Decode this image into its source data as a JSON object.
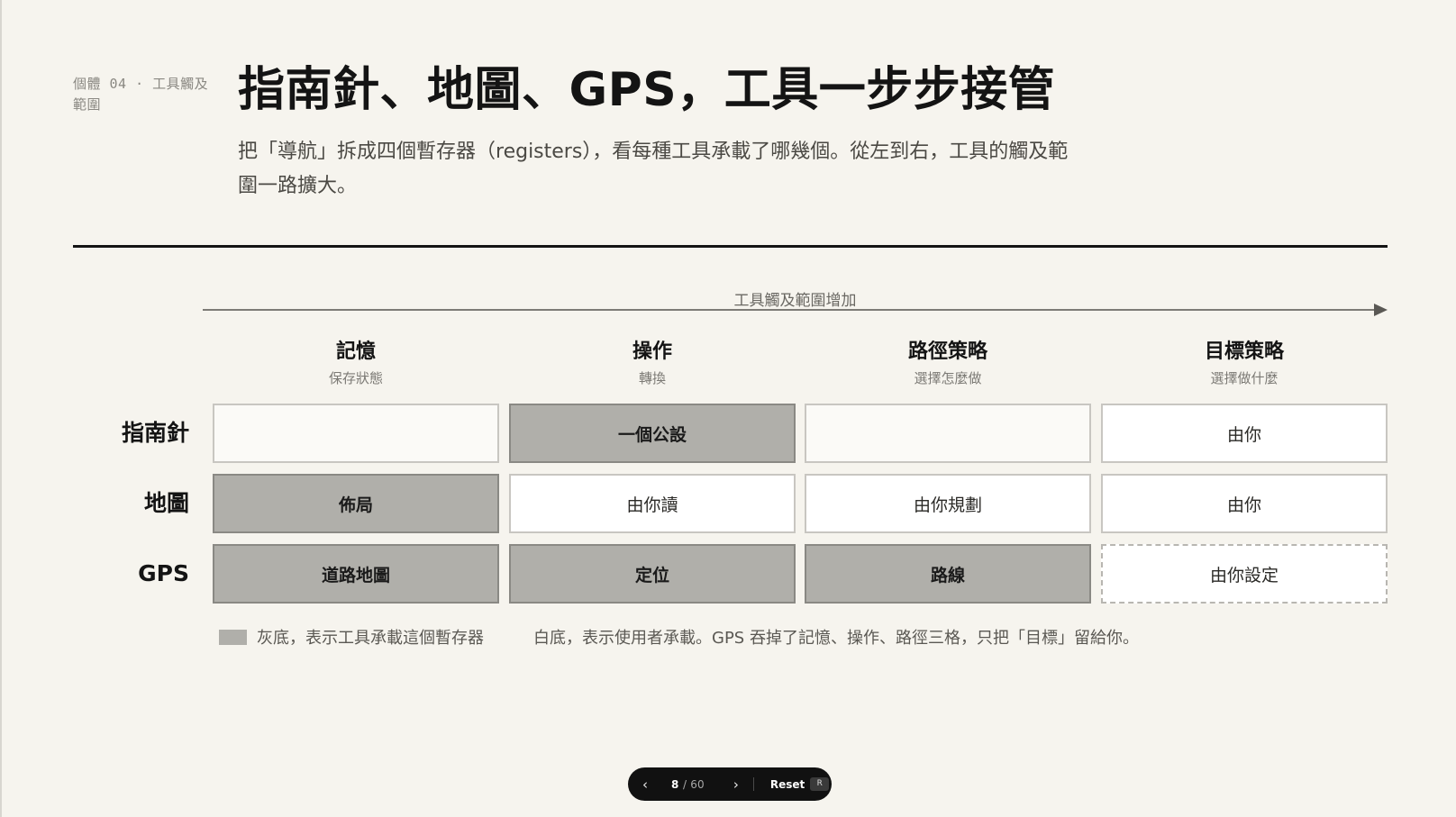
{
  "header": {
    "eyebrow": "個體 04 · 工具觸及範圍",
    "title": "指南針、地圖、GPS，工具一步步接管",
    "subtitle": "把「導航」拆成四個暫存器（registers），看每種工具承載了哪幾個。從左到右，工具的觸及範圍一路擴大。"
  },
  "axis": {
    "label": "工具觸及範圍增加"
  },
  "columns": [
    {
      "name": "記憶",
      "sub": "保存狀態"
    },
    {
      "name": "操作",
      "sub": "轉換"
    },
    {
      "name": "路徑策略",
      "sub": "選擇怎麼做"
    },
    {
      "name": "目標策略",
      "sub": "選擇做什麼"
    }
  ],
  "rows": [
    {
      "label": "指南針",
      "cells": [
        {
          "text": "",
          "kind": "empty"
        },
        {
          "text": "一個公設",
          "kind": "tool"
        },
        {
          "text": "",
          "kind": "empty"
        },
        {
          "text": "由你",
          "kind": "user"
        }
      ]
    },
    {
      "label": "地圖",
      "cells": [
        {
          "text": "佈局",
          "kind": "tool"
        },
        {
          "text": "由你讀",
          "kind": "user"
        },
        {
          "text": "由你規劃",
          "kind": "user"
        },
        {
          "text": "由你",
          "kind": "user"
        }
      ]
    },
    {
      "label": "GPS",
      "cells": [
        {
          "text": "道路地圖",
          "kind": "tool"
        },
        {
          "text": "定位",
          "kind": "tool"
        },
        {
          "text": "路線",
          "kind": "tool"
        },
        {
          "text": "由你設定",
          "kind": "goal"
        }
      ]
    }
  ],
  "legend": {
    "tool_label": "灰底，表示工具承載這個暫存器",
    "user_label": "白底，表示使用者承載。GPS 吞掉了記憶、操作、路徑三格，只把「目標」留給你。"
  },
  "pager": {
    "prev_icon": "chevron-left",
    "next_icon": "chevron-right",
    "current": "8",
    "total": "/ 60",
    "reset_label": "Reset",
    "reset_key": "R"
  }
}
